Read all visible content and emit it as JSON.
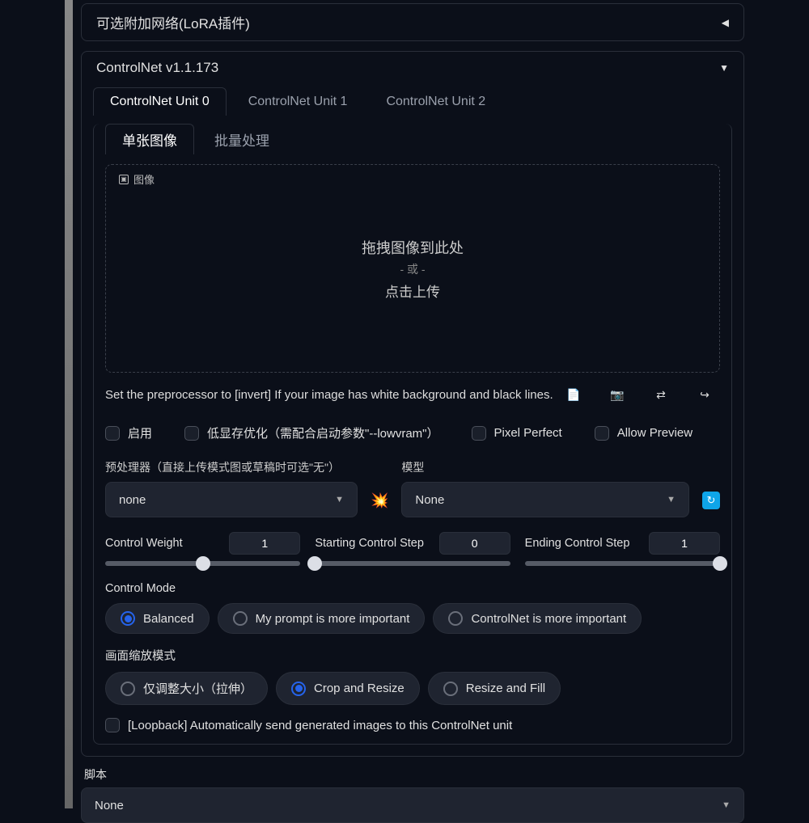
{
  "accordions": {
    "lora": {
      "title": "可选附加网络(LoRA插件)"
    },
    "controlnet": {
      "title": "ControlNet v1.1.173"
    }
  },
  "units": [
    "ControlNet Unit 0",
    "ControlNet Unit 1",
    "ControlNet Unit 2"
  ],
  "subtabs": {
    "single": "单张图像",
    "batch": "批量处理"
  },
  "dropzone": {
    "tag": "图像",
    "line1": "拖拽图像到此处",
    "line2": "- 或 -",
    "line3": "点击上传"
  },
  "hint": "Set the preprocessor to [invert] If your image has white background and black lines.",
  "checks": {
    "enable": "启用",
    "lowvram": "低显存优化（需配合启动参数\"--lowvram\"）",
    "pixel": "Pixel Perfect",
    "preview": "Allow Preview"
  },
  "preprocessor": {
    "label": "预处理器（直接上传模式图或草稿时可选\"无\"）",
    "value": "none"
  },
  "model": {
    "label": "模型",
    "value": "None"
  },
  "sliders": {
    "weight": {
      "label": "Control Weight",
      "value": "1",
      "pos": 50
    },
    "start": {
      "label": "Starting Control Step",
      "value": "0",
      "pos": 0
    },
    "end": {
      "label": "Ending Control Step",
      "value": "1",
      "pos": 100
    }
  },
  "control_mode": {
    "label": "Control Mode",
    "options": [
      "Balanced",
      "My prompt is more important",
      "ControlNet is more important"
    ],
    "selected": 0
  },
  "resize_mode": {
    "label": "画面缩放模式",
    "options": [
      "仅调整大小（拉伸）",
      "Crop and Resize",
      "Resize and Fill"
    ],
    "selected": 1
  },
  "loopback": "[Loopback] Automatically send generated images to this ControlNet unit",
  "script": {
    "label": "脚本",
    "value": "None"
  }
}
